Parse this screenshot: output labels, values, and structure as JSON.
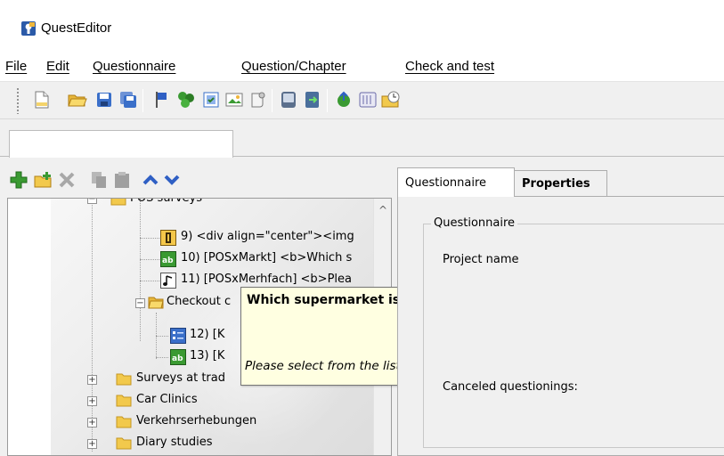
{
  "window": {
    "title": "QuestEditor",
    "icon": "questeditor-app-icon"
  },
  "menu": [
    {
      "label": "File",
      "accel": "F"
    },
    {
      "label": "Edit",
      "accel": "E"
    },
    {
      "label": "Questionnaire",
      "accel": "Q"
    },
    {
      "label": "Question/Chapter",
      "accel": "u"
    },
    {
      "label": "Check and test",
      "accel": "C"
    }
  ],
  "toolbar": {
    "buttons": [
      "new-document-icon",
      "open-folder-icon",
      "save-icon",
      "save-all-icon",
      "flag-icon",
      "plugin-icon",
      "properties-icon",
      "image-icon",
      "scroll-icon",
      "database-icon",
      "export-icon",
      "publish-icon",
      "calendar-icon",
      "clock-folder-icon"
    ]
  },
  "tree_toolbar": {
    "buttons": [
      "add-icon",
      "add-folder-icon",
      "delete-icon",
      "copy-icon",
      "paste-icon",
      "move-up-icon",
      "move-down-icon"
    ]
  },
  "tree": {
    "nodes": [
      {
        "label": "POS surveys",
        "type": "folder-open"
      },
      {
        "label": "9) <div align=\"center\"><img",
        "type": "question-ranking"
      },
      {
        "label": "10) [POSxMarkt] <b>Which s",
        "type": "question-single-choice"
      },
      {
        "label": "11) [POSxMerhfach] <b>Plea",
        "type": "question-audio"
      },
      {
        "label": "Checkout c",
        "type": "folder-open"
      },
      {
        "label": "12) [K",
        "type": "question-matrix"
      },
      {
        "label": "13) [K",
        "type": "question-single-choice"
      },
      {
        "label": "Surveys at trad",
        "type": "folder"
      },
      {
        "label": "Car Clinics",
        "type": "folder"
      },
      {
        "label": "Verkehrserhebungen",
        "type": "folder"
      },
      {
        "label": "Diary studies",
        "type": "folder"
      }
    ]
  },
  "tooltip": {
    "title": "Which supermarket is it?",
    "body": "Please select from the list below."
  },
  "right_tabs": [
    {
      "label": "Questionnaire",
      "active": true
    },
    {
      "label": "Properties",
      "active": false
    }
  ],
  "properties": {
    "group_title": "Questionnaire",
    "project_name_label": "Project name",
    "canceled_label": "Canceled questionings:"
  },
  "colors": {
    "accent_green": "#3a9a32",
    "folder_yellow": "#f2c94c",
    "tooltip_bg": "#ffffe1",
    "arrow_blue": "#2f5fc4"
  }
}
